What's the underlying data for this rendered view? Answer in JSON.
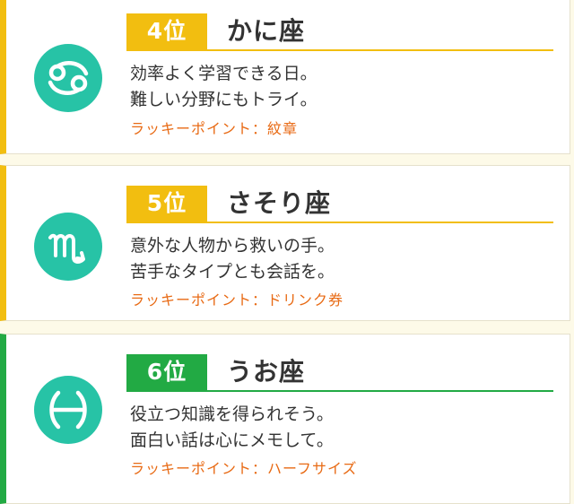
{
  "entries": [
    {
      "rank": "4位",
      "sign": "かに座",
      "fortune": [
        "効率よく学習できる日。",
        "難しい分野にもトライ。"
      ],
      "lucky": "ラッキーポイント：紋章",
      "icon": "cancer-icon",
      "color": "#f2be10"
    },
    {
      "rank": "5位",
      "sign": "さそり座",
      "fortune": [
        "意外な人物から救いの手。",
        "苦手なタイプとも会話を。"
      ],
      "lucky": "ラッキーポイント：ドリンク券",
      "icon": "scorpio-icon",
      "color": "#f2be10"
    },
    {
      "rank": "6位",
      "sign": "うお座",
      "fortune": [
        "役立つ知識を得られそう。",
        "面白い話は心にメモして。"
      ],
      "lucky": "ラッキーポイント：ハーフサイズ",
      "icon": "pisces-icon",
      "color": "#22aa44"
    }
  ],
  "icon_bg_color": "#27c3a6",
  "lucky_text_color": "#e86a14"
}
